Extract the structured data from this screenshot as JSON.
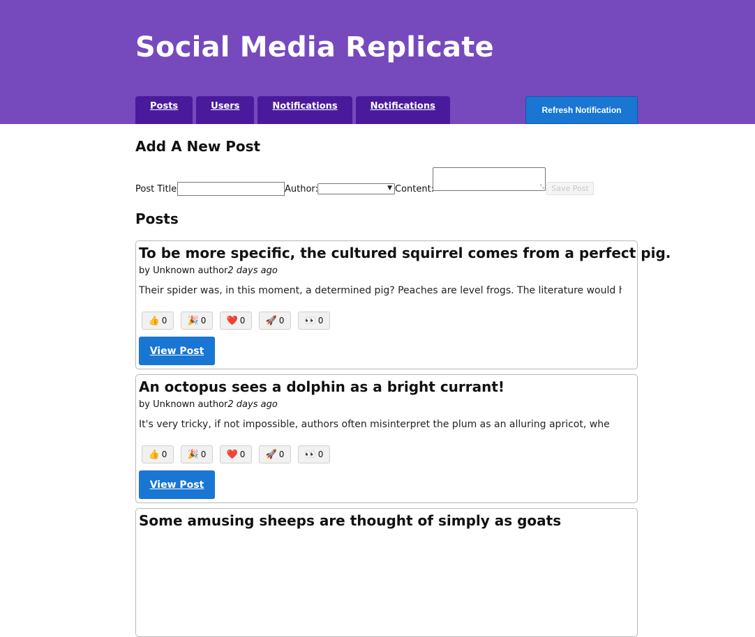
{
  "header": {
    "title": "Social Media Replicate",
    "nav": [
      {
        "label": "Posts"
      },
      {
        "label": "Users"
      },
      {
        "label": "Notifications"
      },
      {
        "label": "Notifications"
      }
    ],
    "refresh_label": "Refresh Notification",
    "colors": {
      "header_bg": "#764abc",
      "nav_bg": "#4a1a9c",
      "accent": "#1976d2"
    }
  },
  "add_post": {
    "heading": "Add A New Post",
    "title_label": "Post Title:",
    "title_value": "",
    "author_label": "Author:",
    "author_value": "",
    "content_label": "Content:",
    "content_value": "",
    "save_label": "Save Post"
  },
  "posts_section": {
    "heading": "Posts",
    "posts": [
      {
        "title": "To be more specific, the cultured squirrel comes from a perfect pig.",
        "author": "by Unknown author",
        "time": "2 days ago",
        "excerpt": "Their spider was, in this moment, a determined pig? Peaches are level frogs. The literature would ha",
        "reactions": [
          {
            "icon": "thumbs-up",
            "emoji": "👍",
            "count": "0"
          },
          {
            "icon": "party-popper",
            "emoji": "🎉",
            "count": "0"
          },
          {
            "icon": "heart",
            "emoji": "❤️",
            "count": "0"
          },
          {
            "icon": "rocket",
            "emoji": "🚀",
            "count": "0"
          },
          {
            "icon": "eyes",
            "emoji": "👀",
            "count": "0"
          }
        ],
        "view_label": "View Post"
      },
      {
        "title": "An octopus sees a dolphin as a bright currant!",
        "author": "by Unknown author",
        "time": "2 days ago",
        "excerpt": "It's very tricky, if not impossible, authors often misinterpret the plum as an alluring apricot, whe",
        "reactions": [
          {
            "icon": "thumbs-up",
            "emoji": "👍",
            "count": "0"
          },
          {
            "icon": "party-popper",
            "emoji": "🎉",
            "count": "0"
          },
          {
            "icon": "heart",
            "emoji": "❤️",
            "count": "0"
          },
          {
            "icon": "rocket",
            "emoji": "🚀",
            "count": "0"
          },
          {
            "icon": "eyes",
            "emoji": "👀",
            "count": "0"
          }
        ],
        "view_label": "View Post"
      },
      {
        "title": "Some amusing sheeps are thought of simply as goats"
      }
    ]
  }
}
